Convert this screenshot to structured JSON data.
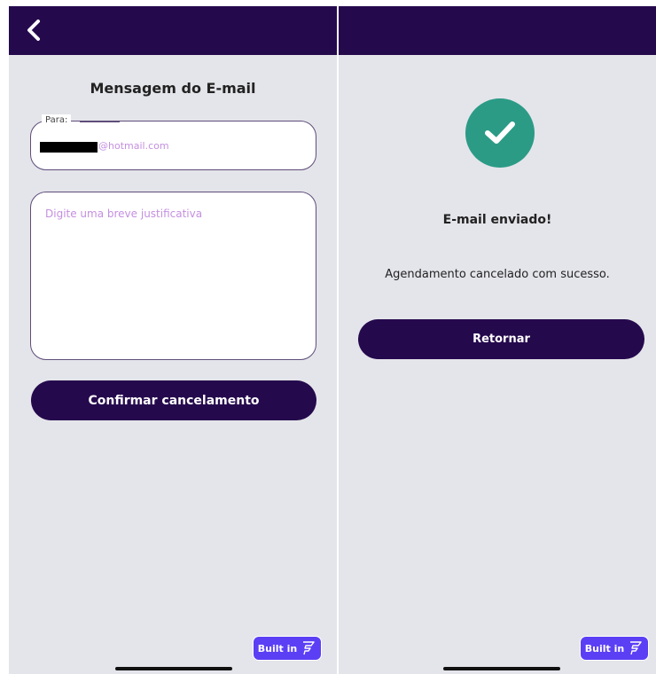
{
  "left_screen": {
    "title": "Mensagem do E-mail",
    "to_label": "Para:",
    "to_value": "@hotmail.com",
    "message_placeholder": "Digite uma breve justificativa",
    "message_value": "",
    "confirm_label": "Confirmar cancelamento",
    "badge_label": "Built in"
  },
  "right_screen": {
    "status_title": "E-mail enviado!",
    "status_message": "Agendamento cancelado com sucesso.",
    "return_label": "Retornar",
    "badge_label": "Built in"
  },
  "icons": {
    "back": "chevron-left-icon",
    "success": "check-circle-icon",
    "badge": "flutterflow-icon"
  },
  "colors": {
    "header": "#25094d",
    "background": "#e4e5ea",
    "primary_button": "#25094d",
    "success": "#2b9b86",
    "placeholder": "#c48fe0",
    "badge": "#5b3ff5"
  }
}
